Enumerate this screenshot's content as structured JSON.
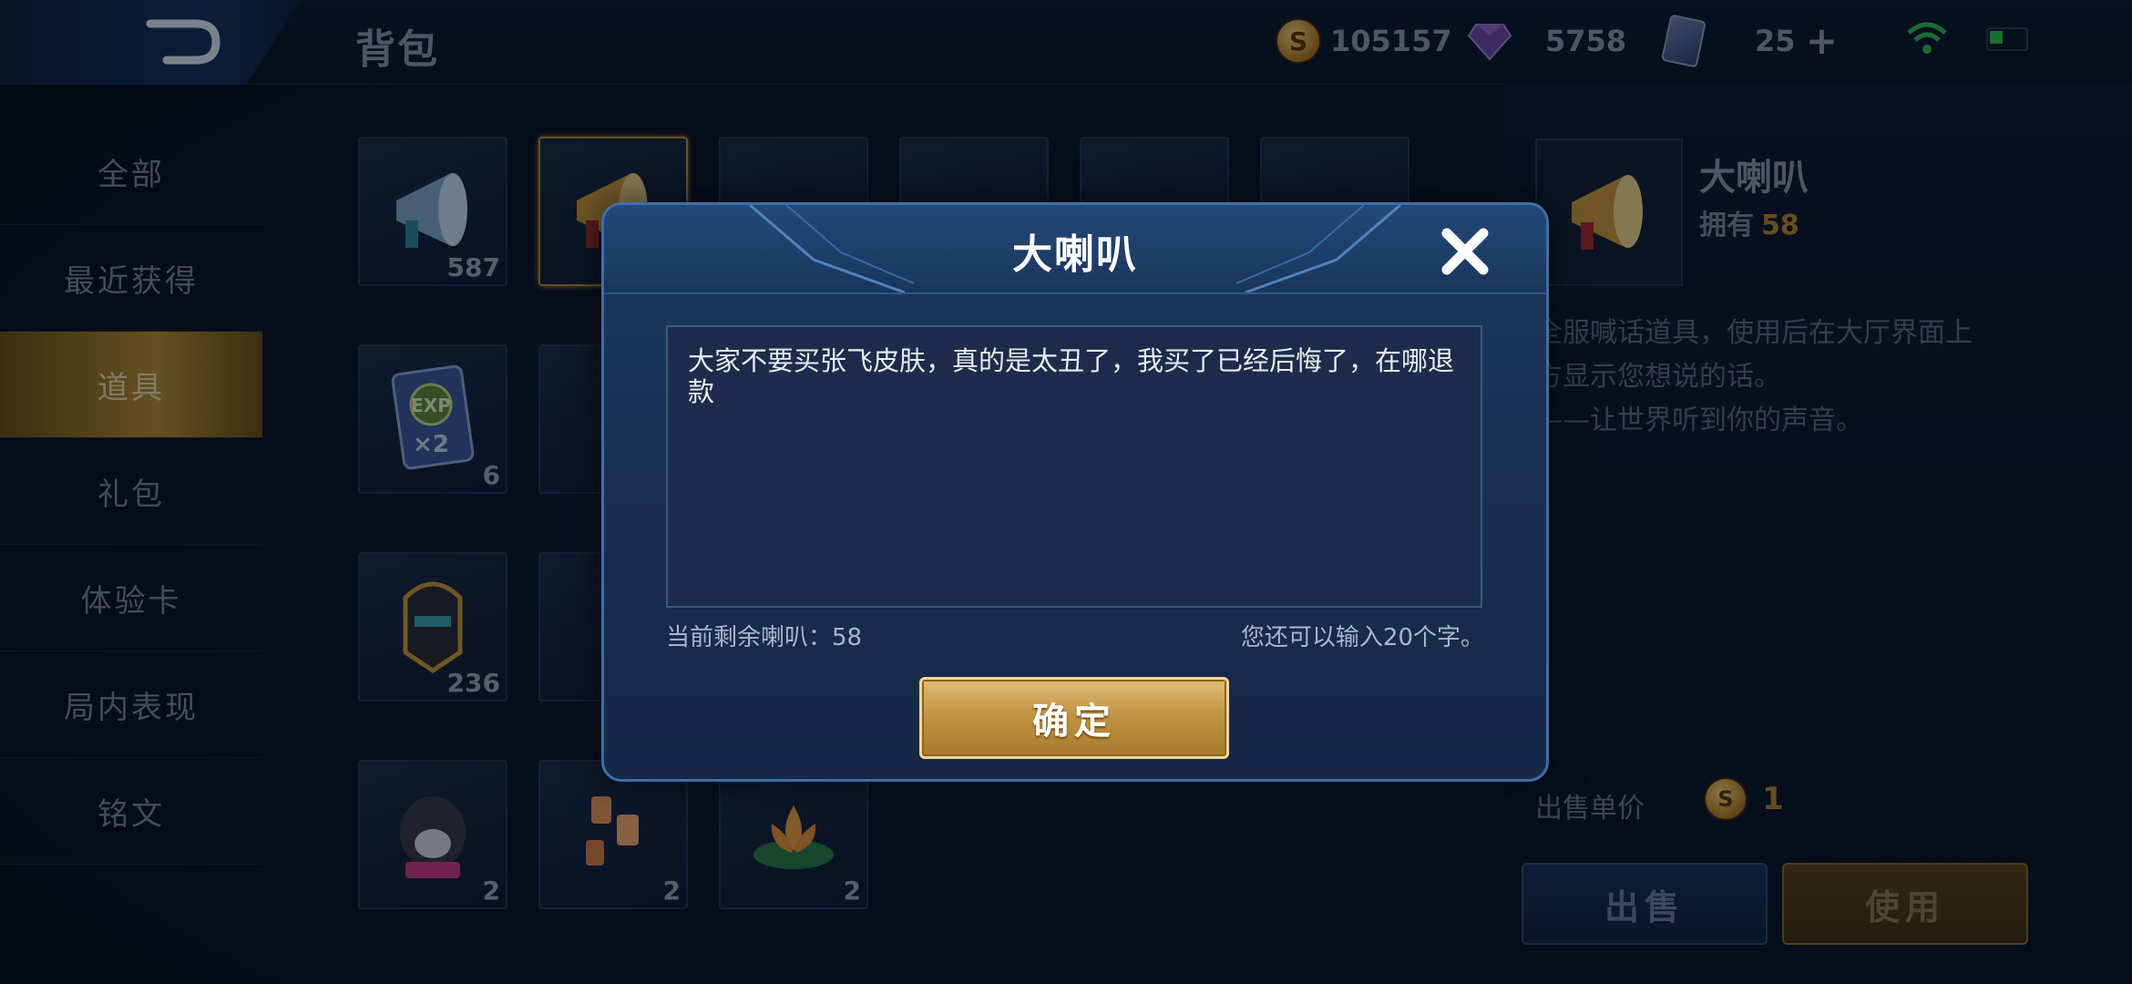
{
  "header": {
    "title": "背包",
    "gold": "105157",
    "gems": "5758",
    "cards": "25"
  },
  "sidebar": {
    "items": [
      {
        "label": "全部"
      },
      {
        "label": "最近获得"
      },
      {
        "label": "道具",
        "active": true
      },
      {
        "label": "礼包"
      },
      {
        "label": "体验卡"
      },
      {
        "label": "局内表现"
      },
      {
        "label": "铭文"
      }
    ]
  },
  "inventory": {
    "counts": [
      "587",
      "6",
      "236",
      "2",
      "2",
      "2"
    ]
  },
  "detail": {
    "name": "大喇叭",
    "own_label": "拥有",
    "own_count": "58",
    "description": "全服喊话道具，使用后在大厅界面上\n方显示您想说的话。\n——让世界听到你的声音。",
    "sell_label": "出售单价",
    "sell_price": "1",
    "sell_button": "出售",
    "use_button": "使用"
  },
  "modal": {
    "title": "大喇叭",
    "message": "大家不要买张飞皮肤，真的是太丑了，我买了已经后悔了，在哪退款",
    "remaining_label": "当前剩余喇叭：58",
    "limit_label": "您还可以输入20个字。",
    "confirm_label": "确定"
  },
  "colors": {
    "accent_gold": "#c39445",
    "modal_border": "#3d6ea8",
    "sidebar_active": "#b98e33"
  }
}
